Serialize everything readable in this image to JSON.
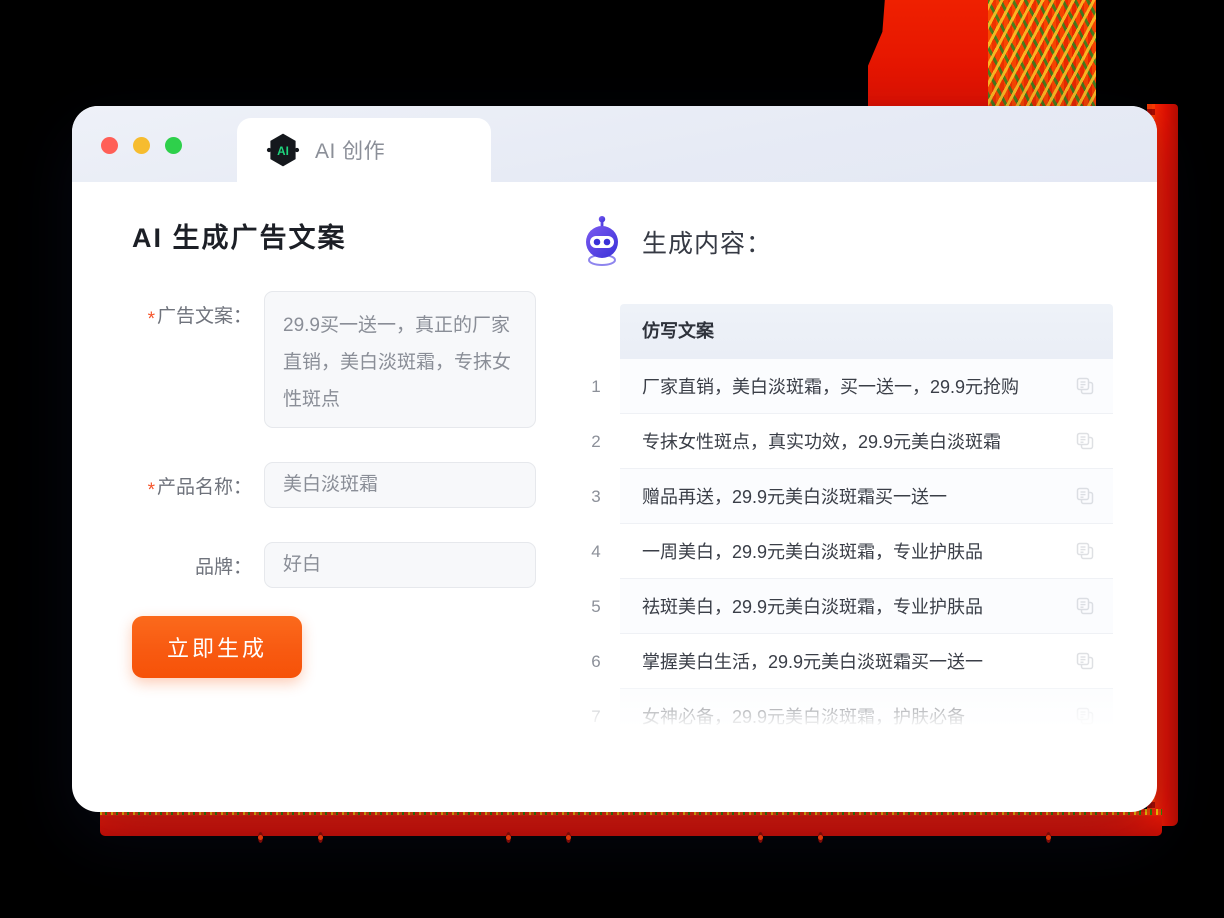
{
  "window": {
    "traffic_lights": [
      "close",
      "minimize",
      "maximize"
    ],
    "tab": {
      "label": "AI 创作",
      "icon": "ai-hexagon-icon",
      "badge_text": "AI"
    }
  },
  "left_panel": {
    "title": "AI 生成广告文案",
    "fields": [
      {
        "label": "广告文案：",
        "required": true,
        "value": "29.9买一送一，真正的厂家直销，美白淡斑霜，专抹女性斑点",
        "type": "textarea"
      },
      {
        "label": "产品名称：",
        "required": true,
        "value": "美白淡斑霜",
        "type": "text"
      },
      {
        "label": "品牌：",
        "required": false,
        "value": "好白",
        "type": "text"
      }
    ],
    "submit_button": "立即生成"
  },
  "right_panel": {
    "icon": "robot-icon",
    "title": "生成内容：",
    "table": {
      "header": "仿写文案",
      "rows": [
        {
          "index": "1",
          "text": "厂家直销，美白淡斑霜，买一送一，29.9元抢购"
        },
        {
          "index": "2",
          "text": "专抹女性斑点，真实功效，29.9元美白淡斑霜"
        },
        {
          "index": "3",
          "text": "赠品再送，29.9元美白淡斑霜买一送一"
        },
        {
          "index": "4",
          "text": "一周美白，29.9元美白淡斑霜，专业护肤品"
        },
        {
          "index": "5",
          "text": "祛斑美白，29.9元美白淡斑霜，专业护肤品"
        },
        {
          "index": "6",
          "text": "掌握美白生活，29.9元美白淡斑霜买一送一"
        },
        {
          "index": "7",
          "text": "女神必备，29.9元美白淡斑霜，护肤必备"
        }
      ],
      "row_action_icon": "copy-icon"
    }
  },
  "colors": {
    "accent_orange": "#f8580f",
    "required_red": "#f5542a",
    "robot_purple": "#5b4ee5",
    "badge_green": "#1fd67e",
    "titlebar": "#e7ebf5",
    "table_header": "#eef2f8",
    "decor_red": "#e81b00"
  }
}
